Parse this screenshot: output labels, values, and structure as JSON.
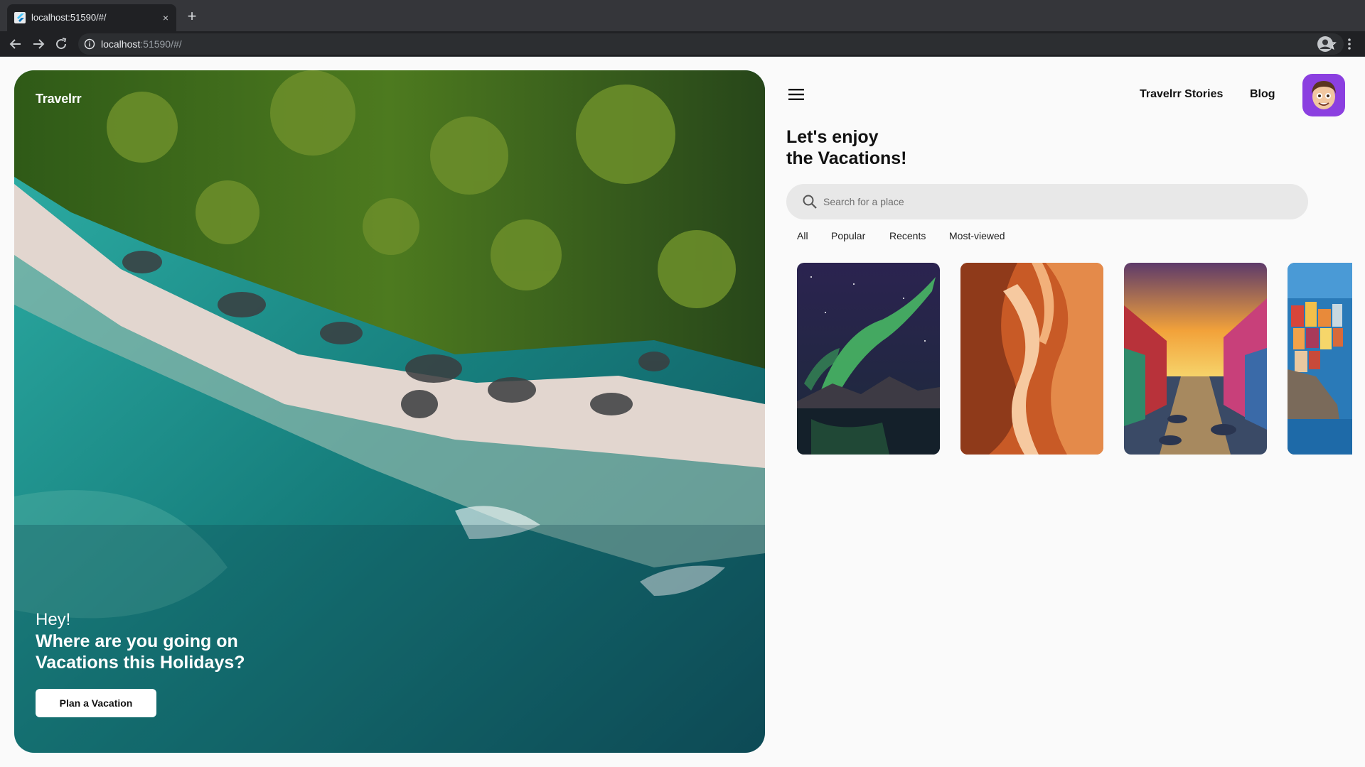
{
  "browser": {
    "tab_title": "localhost:51590/#/",
    "tab_close": "×",
    "new_tab": "+",
    "url_host": "localhost",
    "url_rest": ":51590/#/"
  },
  "app": {
    "brand": "Travelrr",
    "hero": {
      "greeting": "Hey!",
      "line1": "Where are you going on",
      "line2": "Vacations this Holidays?",
      "cta_label": "Plan a Vacation"
    },
    "nav": {
      "stories": "Travelrr Stories",
      "blog": "Blog"
    },
    "headline": {
      "line1": "Let's enjoy",
      "line2": "the Vacations!"
    },
    "search": {
      "placeholder": "Search for a place"
    },
    "filters": [
      "All",
      "Popular",
      "Recents",
      "Most-viewed"
    ],
    "cards": [
      {
        "name": "aurora-card",
        "icon": "aurora-image"
      },
      {
        "name": "canyon-card",
        "icon": "canyon-image"
      },
      {
        "name": "canal-card",
        "icon": "canal-image"
      },
      {
        "name": "coastal-village-card",
        "icon": "village-image"
      }
    ],
    "colors": {
      "accent": "#8b3fe0",
      "search_bg": "#e8e8e8",
      "page_bg": "#fafafa",
      "hero_sea": "#1a8c86",
      "hero_forest": "#3f6b1e"
    }
  }
}
